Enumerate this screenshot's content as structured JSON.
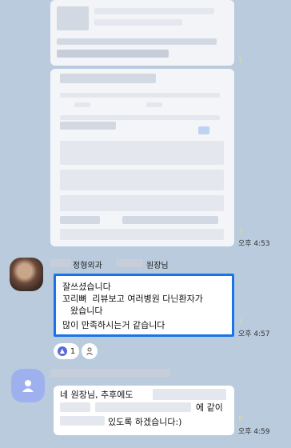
{
  "messages": [
    {
      "id": "m1",
      "type": "image",
      "unread": "1"
    },
    {
      "id": "m2",
      "type": "image",
      "unread": "2",
      "time": "오후 4:53"
    },
    {
      "id": "m3",
      "sender_suffix": "정형외과",
      "sender_suffix2": "원장님",
      "text_lines": [
        "잘쓰셨습니다",
        "꼬리뼈  리뷰보고 여러병원 다닌환자가",
        "왔습니다",
        "많이 만족하시는거 같습니다"
      ],
      "unread": "3",
      "time": "오후 4:57",
      "reaction": {
        "icon": "thumbs-up-icon",
        "count": "1"
      }
    },
    {
      "id": "m4",
      "text_line1": "네 원장님, 추후에도",
      "text_line2_tail": "에 같이",
      "text_line3_tail": "있도록 하겠습니다:)",
      "unread": "6",
      "time": "오후 4:59"
    }
  ],
  "colors": {
    "background": "#b9cbdd",
    "highlight": "#1a73e8",
    "reaction": "#5b6bd6",
    "unread": "#e8dc7a"
  }
}
